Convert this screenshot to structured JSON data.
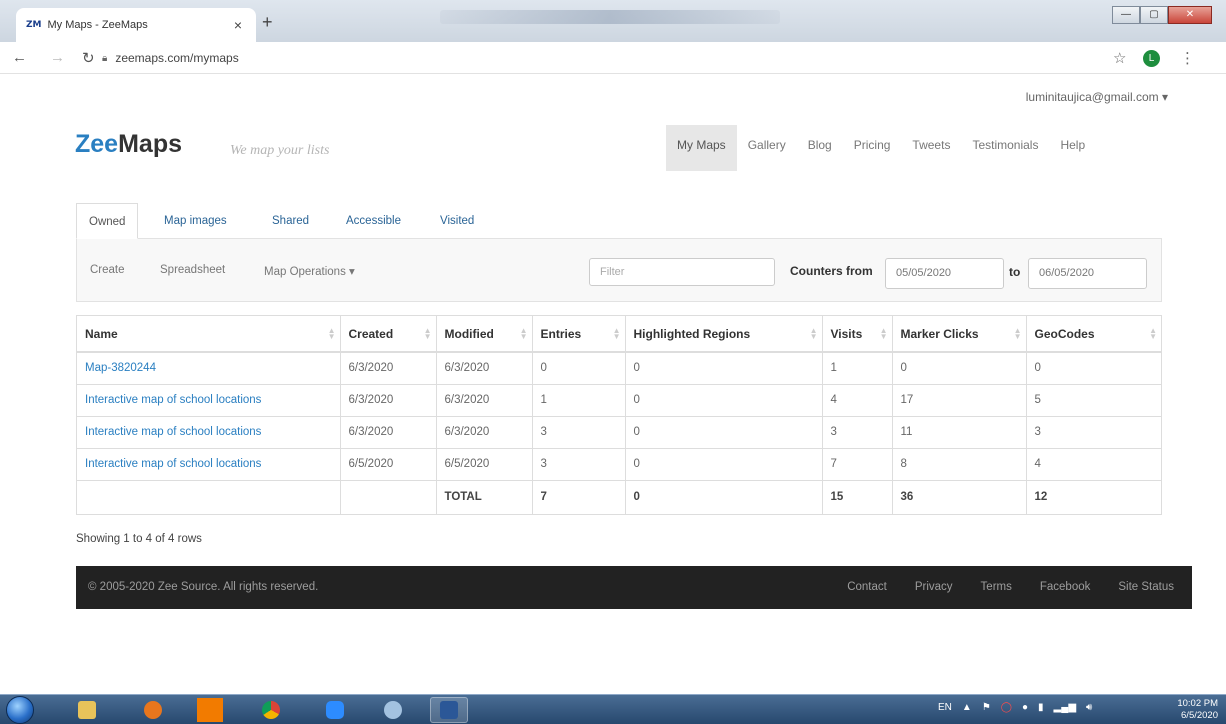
{
  "browser": {
    "tab_title": "My Maps - ZeeMaps",
    "tab_favicon": "ZM",
    "url": "zeemaps.com/mymaps",
    "profile_initial": "L",
    "icons": {
      "back": "arrow-left-icon",
      "forward": "arrow-right-icon",
      "reload": "reload-icon",
      "lock": "lock-icon",
      "star": "star-icon",
      "menu": "kebab-menu-icon"
    }
  },
  "header": {
    "user_email": "luminitaujica@gmail.com",
    "logo_prefix": "Zee",
    "logo_suffix": "Maps",
    "tagline": "We map your lists",
    "nav": [
      "My Maps",
      "Gallery",
      "Blog",
      "Pricing",
      "Tweets",
      "Testimonials",
      "Help"
    ],
    "active_nav": "My Maps"
  },
  "tabs": [
    "Owned",
    "Map images",
    "Shared",
    "Accessible",
    "Visited"
  ],
  "toolbar": {
    "create": "Create",
    "spreadsheet": "Spreadsheet",
    "map_operations": "Map Operations",
    "filter_placeholder": "Filter",
    "counters_from": "Counters from",
    "from_date": "05/05/2020",
    "to": "to",
    "to_date": "06/05/2020"
  },
  "table": {
    "headers": [
      "Name",
      "Created",
      "Modified",
      "Entries",
      "Highlighted Regions",
      "Visits",
      "Marker Clicks",
      "GeoCodes"
    ],
    "rows": [
      [
        "Map-3820244",
        "6/3/2020",
        "6/3/2020",
        "0",
        "0",
        "1",
        "0",
        "0"
      ],
      [
        "Interactive map of school locations",
        "6/3/2020",
        "6/3/2020",
        "1",
        "0",
        "4",
        "17",
        "5"
      ],
      [
        "Interactive map of school locations",
        "6/3/2020",
        "6/3/2020",
        "3",
        "0",
        "3",
        "11",
        "3"
      ],
      [
        "Interactive map of school locations",
        "6/5/2020",
        "6/5/2020",
        "3",
        "0",
        "7",
        "8",
        "4"
      ]
    ],
    "total": [
      "",
      "",
      "TOTAL",
      "7",
      "0",
      "15",
      "36",
      "12"
    ]
  },
  "showing": "Showing 1 to 4 of 4 rows",
  "footer": {
    "copyright": "© 2005-2020 Zee Source. All rights reserved.",
    "links": [
      "Contact",
      "Privacy",
      "Terms",
      "Facebook",
      "Site Status"
    ]
  },
  "taskbar": {
    "lang": "EN",
    "time": "10:02 PM",
    "date": "6/5/2020"
  },
  "colors": {
    "brand_blue": "#2a7fc1",
    "footer_bg": "#222222",
    "taskbar": "#27486e"
  }
}
